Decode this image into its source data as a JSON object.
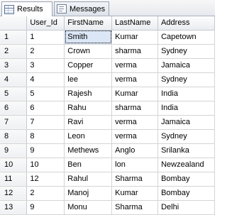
{
  "tabs": [
    {
      "label": "Results",
      "icon": "grid-icon",
      "active": true
    },
    {
      "label": "Messages",
      "icon": "messages-icon",
      "active": false
    }
  ],
  "columns": [
    "User_Id",
    "FirstName",
    "LastName",
    "Address"
  ],
  "rows": [
    {
      "n": "1",
      "cells": [
        "1",
        "Smith",
        "Kumar",
        "Capetown"
      ]
    },
    {
      "n": "2",
      "cells": [
        "2",
        "Crown",
        "sharma",
        "Sydney"
      ]
    },
    {
      "n": "3",
      "cells": [
        "3",
        "Copper",
        "verma",
        "Jamaica"
      ]
    },
    {
      "n": "4",
      "cells": [
        "4",
        "lee",
        "verma",
        "Sydney"
      ]
    },
    {
      "n": "5",
      "cells": [
        "5",
        "Rajesh",
        "Kumar",
        "India"
      ]
    },
    {
      "n": "6",
      "cells": [
        "6",
        "Rahu",
        "sharma",
        "India"
      ]
    },
    {
      "n": "7",
      "cells": [
        "7",
        "Ravi",
        "verma",
        "Jamaica"
      ]
    },
    {
      "n": "8",
      "cells": [
        "8",
        "Leon",
        "verma",
        "Sydney"
      ]
    },
    {
      "n": "9",
      "cells": [
        "9",
        "Methews",
        "Anglo",
        "Srilanka"
      ]
    },
    {
      "n": "10",
      "cells": [
        "10",
        "Ben",
        "lon",
        "Newzealand"
      ]
    },
    {
      "n": "11",
      "cells": [
        "12",
        "Rahul",
        "Sharma",
        "Bombay"
      ]
    },
    {
      "n": "12",
      "cells": [
        "2",
        "Manoj",
        "Kumar",
        "Bombay"
      ]
    },
    {
      "n": "13",
      "cells": [
        "9",
        "Monu",
        "Sharma",
        "Delhi"
      ]
    }
  ]
}
